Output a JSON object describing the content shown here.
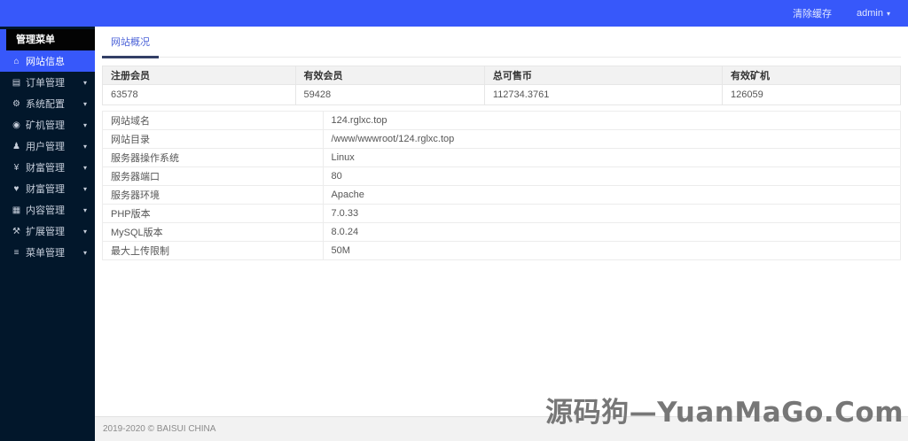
{
  "topbar": {
    "clear_cache": "清除缓存",
    "user": "admin"
  },
  "sidebar": {
    "header": "管理菜单",
    "items": [
      {
        "icon": "home",
        "label": "网站信息",
        "active": true,
        "chevron": false
      },
      {
        "icon": "orders",
        "label": "订单管理",
        "active": false,
        "chevron": true
      },
      {
        "icon": "settings",
        "label": "系统配置",
        "active": false,
        "chevron": true
      },
      {
        "icon": "miner",
        "label": "矿机管理",
        "active": false,
        "chevron": true
      },
      {
        "icon": "users",
        "label": "用户管理",
        "active": false,
        "chevron": true
      },
      {
        "icon": "money",
        "label": "财富管理",
        "active": false,
        "chevron": true
      },
      {
        "icon": "heart",
        "label": "财富管理",
        "active": false,
        "chevron": true
      },
      {
        "icon": "content",
        "label": "内容管理",
        "active": false,
        "chevron": true
      },
      {
        "icon": "wrench",
        "label": "扩展管理",
        "active": false,
        "chevron": true
      },
      {
        "icon": "menu",
        "label": "菜单管理",
        "active": false,
        "chevron": true
      }
    ]
  },
  "tabs": {
    "overview": "网站概况"
  },
  "stats": {
    "headers": [
      "注册会员",
      "有效会员",
      "总可售币",
      "有效矿机"
    ],
    "values": [
      "63578",
      "59428",
      "112734.3761",
      "126059"
    ],
    "col_widths": [
      "24.1%",
      "23.6%",
      "30.2%",
      "22.1%"
    ]
  },
  "site_info": {
    "rows": [
      {
        "label": "网站域名",
        "value": "124.rglxc.top"
      },
      {
        "label": "网站目录",
        "value": "/www/wwwroot/124.rglxc.top"
      },
      {
        "label": "服务器操作系统",
        "value": "Linux"
      },
      {
        "label": "服务器端口",
        "value": "80"
      },
      {
        "label": "服务器环境",
        "value": "Apache"
      },
      {
        "label": "PHP版本",
        "value": "7.0.33"
      },
      {
        "label": "MySQL版本",
        "value": "8.0.24"
      },
      {
        "label": "最大上传限制",
        "value": "50M"
      }
    ]
  },
  "footer": {
    "text": "2019-2020 © BAISUI CHINA"
  },
  "watermark": {
    "text": "源码狗—YuanMaGo.Com"
  },
  "icons": {
    "home": "⌂",
    "orders": "▤",
    "settings": "⚙",
    "miner": "◉",
    "users": "♟",
    "money": "¥",
    "heart": "♥",
    "content": "▦",
    "wrench": "⚒",
    "menu": "≡",
    "chevron_down": "▾"
  },
  "colors": {
    "topbar": "#3758fa",
    "sidebar": "#02172b",
    "active_item": "#3758fa",
    "tab_text": "#4c63d8",
    "tab_underline": "#333f66",
    "table_header_bg": "#f2f2f2",
    "footer_bg": "#f2f2f2"
  }
}
